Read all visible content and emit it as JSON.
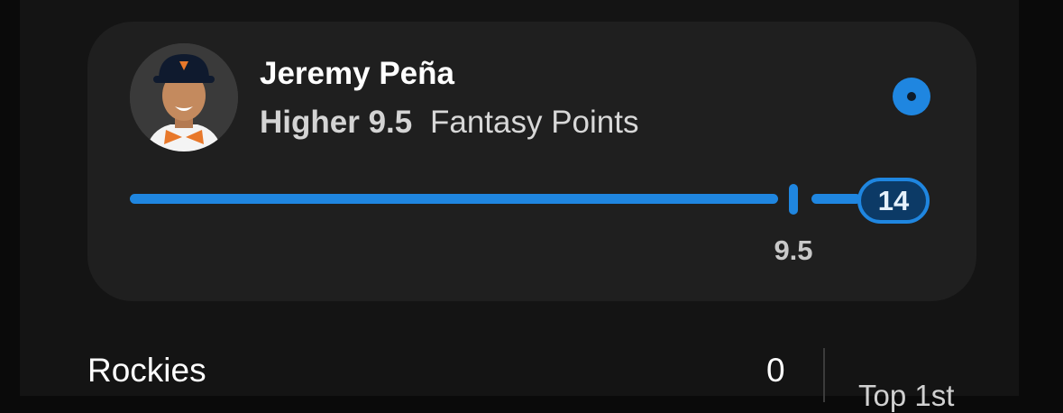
{
  "player": {
    "name": "Jeremy Peña",
    "direction": "Higher",
    "line": "9.5",
    "stat": "Fantasy Points",
    "avatar_icon": "player-headshot"
  },
  "progress": {
    "current_value": "14",
    "line_label": "9.5",
    "accent_color": "#1f86e0"
  },
  "game": {
    "team": "Rockies",
    "score": "0",
    "inning": "Top 1st"
  }
}
